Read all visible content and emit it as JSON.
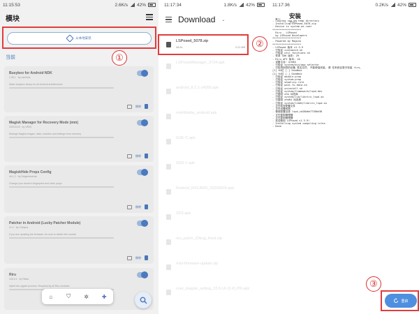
{
  "panel1": {
    "status": {
      "time": "11:15:53",
      "net": "2.6K/s",
      "battery": "42%"
    },
    "title": "模块",
    "install_button_label": "从本地安装",
    "section_label": "当前",
    "modules": [
      {
        "name": "Busybox for Android NDK",
        "sub": "1.36.1 · by osm0sis",
        "desc": "Static busybox binary for all Android architectures"
      },
      {
        "name": "Magisk Manager for Recovery Mode (mm)",
        "sub": "2023.8.15 · by VR25",
        "desc": "Manage Magisk images, data, modules and settings from recovery"
      },
      {
        "name": "MagiskHide Props Config",
        "sub": "v6.1.2 · by Didgeridoohan",
        "desc": "Change your device's fingerprint and other props"
      },
      {
        "name": "Patcher in Android (Lucky Patcher Module)",
        "sub": "v1.0 · by Chelpus",
        "desc": "If you are updating the firmware, be sure to delete this module"
      },
      {
        "name": "Riru",
        "sub": "v25.4.4 · by Rikka",
        "desc": "Inject into zygote process. Required by all Riru modules"
      }
    ],
    "action_label": "移除",
    "annotation": "①"
  },
  "panel2": {
    "status": {
      "time": "11:17:34",
      "net": "1.8K/s",
      "battery": "42%"
    },
    "title": "Download",
    "caret": "⌄",
    "highlighted_file": {
      "name": "LSPosed_5078.zip",
      "date": "08:44",
      "size": "2.21 MB"
    },
    "other_files": [
      "LSPosedManager_3734.apk",
      "android_8.2.1-14095.apk",
      "mmlibbaby_android.apk",
      "GSE-C.apk",
      "SDD-1.apk",
      "Rxdroid_RXCARD_20200609.apk",
      "SD3.apk",
      "riru_patch_20bug_fixed.zip",
      "miui-firmware-update.zip",
      "core_magisk_setting_22.6-UI-11-8_PR.apk"
    ],
    "annotation": "②"
  },
  "panel3": {
    "status": {
      "time": "11:17:36",
      "net": "0.2K/s",
      "battery": "42%"
    },
    "title": "安装",
    "subtitle": "完成了",
    "log_lines": [
      "- Copying zip to temp directory",
      "- Installing LSPosed_5078.zip",
      "- Device is system-as-root",
      "*******************",
      "  Riru - LSPosed",
      "  by LSPosed Developers",
      "*******************",
      "- Powered by Magisk",
      "*******************",
      "- LSPosed 版本 v1.3.9",
      "- 已验证 customize.sh",
      "- 已验证 util_functions.sh",
      "- 安卓 SDK 版本: 29",
      "- Riru API 版本: 10",
      "- 设备平台: arm64",
      "- 已验证 system/bin/app_selector",
      "- 已检测到您的设备 签名文件, 不能单独安装, 请 在系统目录中安装 riru。",
      "[1] 64位 [-] Sandbox",
      "[1] 64位 [-] Sandbox",
      "- 已验证 module.prop",
      "- 已验证 system.prop",
      "- 已验证 sepolicy.rule",
      "- 已验证 post-fs-data.sh",
      "- 已验证 uninstall.sh",
      "- 已验证 system/framework/lspd.dex",
      "- 已复制 arm 动态库",
      "- 已验证 system/lib/libriru_lspd.so",
      "- 已复制 arm64 动态库",
      "- 已验证 system/lib64/libriru_lspd.so",
      "- 正在检查配置文件",
      "- 正在设置权限",
      "- 使用配置目录 lspd_cd28b6e77386e38",
      "- 正在复制管理器",
      "- 正在复制管理器",
      "- 欢迎使用 LSPosed v1.3.9!",
      "- Installing system compiling rules",
      "- Done"
    ],
    "reboot_label": "重启",
    "annotation": "③"
  },
  "colors": {
    "accent": "#4a76b8",
    "highlight": "#e23b3b",
    "reboot_bg": "#4e8fe0"
  }
}
